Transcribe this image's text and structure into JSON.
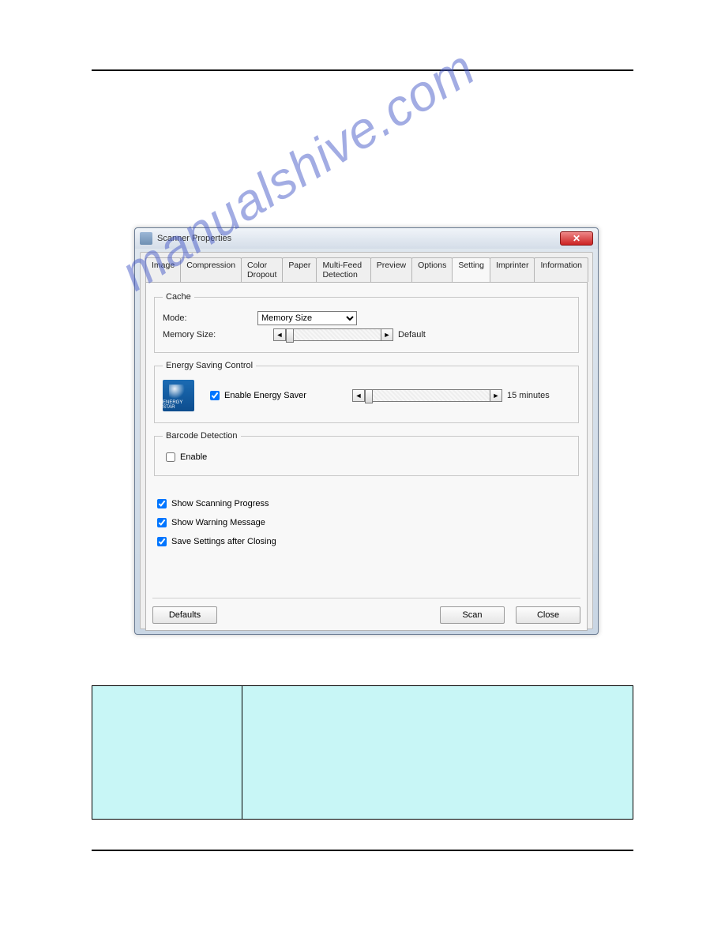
{
  "window": {
    "title": "Scanner Properties"
  },
  "tabs": {
    "items": [
      {
        "label": "Image"
      },
      {
        "label": "Compression"
      },
      {
        "label": "Color Dropout"
      },
      {
        "label": "Paper"
      },
      {
        "label": "Multi-Feed Detection"
      },
      {
        "label": "Preview"
      },
      {
        "label": "Options"
      },
      {
        "label": "Setting"
      },
      {
        "label": "Imprinter"
      },
      {
        "label": "Information"
      }
    ],
    "active_index": 7
  },
  "cache": {
    "legend": "Cache",
    "mode_label": "Mode:",
    "mode_value": "Memory Size",
    "memory_label": "Memory Size:",
    "slider_after": "Default"
  },
  "energy": {
    "legend": "Energy Saving Control",
    "logo_caption": "ENERGY STAR",
    "enable_label": "Enable Energy Saver",
    "enable_checked": true,
    "slider_after": "15 minutes"
  },
  "barcode": {
    "legend": "Barcode Detection",
    "enable_label": "Enable",
    "enable_checked": false
  },
  "checks": {
    "progress": {
      "label": "Show Scanning Progress",
      "checked": true
    },
    "warning": {
      "label": "Show Warning Message",
      "checked": true
    },
    "save": {
      "label": "Save Settings after Closing",
      "checked": true
    }
  },
  "buttons": {
    "defaults": "Defaults",
    "scan": "Scan",
    "close": "Close"
  },
  "watermark": "manualshive.com",
  "info_table": {
    "a": "",
    "b": ""
  }
}
